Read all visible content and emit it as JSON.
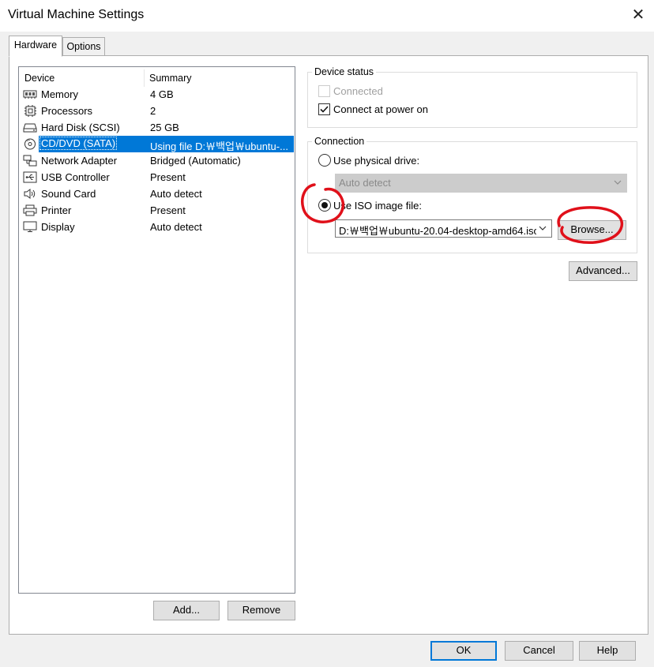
{
  "window": {
    "title": "Virtual Machine Settings",
    "close_glyph": "✕"
  },
  "tabs": [
    {
      "label": "Hardware",
      "active": true
    },
    {
      "label": "Options",
      "active": false
    }
  ],
  "device_list": {
    "columns": {
      "device": "Device",
      "summary": "Summary"
    },
    "rows": [
      {
        "name": "Memory",
        "summary": "4 GB",
        "icon": "memory-icon"
      },
      {
        "name": "Processors",
        "summary": "2",
        "icon": "processor-icon"
      },
      {
        "name": "Hard Disk (SCSI)",
        "summary": "25 GB",
        "icon": "hard-disk-icon"
      },
      {
        "name": "CD/DVD (SATA)",
        "summary": "Using file D:￦백업￦ubuntu-...",
        "icon": "cd-dvd-icon",
        "selected": true
      },
      {
        "name": "Network Adapter",
        "summary": "Bridged (Automatic)",
        "icon": "network-adapter-icon"
      },
      {
        "name": "USB Controller",
        "summary": "Present",
        "icon": "usb-icon"
      },
      {
        "name": "Sound Card",
        "summary": "Auto detect",
        "icon": "speaker-icon"
      },
      {
        "name": "Printer",
        "summary": "Present",
        "icon": "printer-icon"
      },
      {
        "name": "Display",
        "summary": "Auto detect",
        "icon": "monitor-icon"
      }
    ]
  },
  "device_buttons": {
    "add": "Add...",
    "remove": "Remove"
  },
  "device_status": {
    "label": "Device status",
    "connected": {
      "label": "Connected",
      "checked": false,
      "enabled": false
    },
    "connect_at_power_on": {
      "label": "Connect at power on",
      "checked": true
    }
  },
  "connection": {
    "label": "Connection",
    "physical_drive": {
      "label": "Use physical drive:",
      "selected": false,
      "value": "Auto detect"
    },
    "iso_image": {
      "label": "Use ISO image file:",
      "selected": true,
      "value": "D:￦백업￦ubuntu-20.04-desktop-amd64.iso"
    },
    "browse": "Browse..."
  },
  "advanced": "Advanced...",
  "footer": {
    "ok": "OK",
    "cancel": "Cancel",
    "help": "Help"
  },
  "colors": {
    "selection": "#0078d7",
    "annotation": "#e0101a"
  }
}
